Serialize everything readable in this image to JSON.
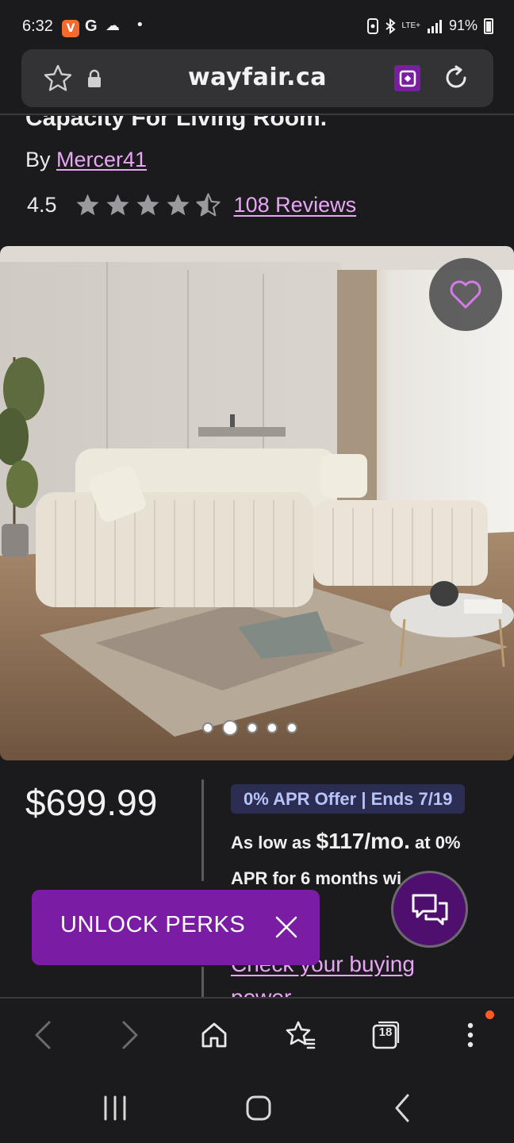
{
  "status_bar": {
    "time": "6:32",
    "google_glyph": "G",
    "brave_glyph": "V",
    "network": "LTE+",
    "battery": "91%",
    "icons": [
      "brave-icon",
      "google-icon",
      "weather-icon",
      "notification-dot-icon",
      "nfc-icon",
      "bluetooth-icon",
      "signal-icon",
      "battery-icon"
    ]
  },
  "url_bar": {
    "domain": "wayfair.ca",
    "icons": [
      "bookmark-star-icon",
      "lock-icon",
      "extension-icon",
      "reload-icon"
    ]
  },
  "product": {
    "title_partial": "Capacity For Living Room.",
    "by_prefix": "By ",
    "brand": "Mercer41",
    "rating": "4.5",
    "rating_fraction": 0.9,
    "reviews": "108 Reviews"
  },
  "gallery": {
    "image_alt": "sectional-sofa-photo",
    "dot_count": 5,
    "active_index": 1
  },
  "pricing": {
    "price": "$699.99",
    "apr_offer": "0% APR Offer",
    "apr_sep": "|",
    "apr_ends": "Ends 7/19",
    "finance_prefix": "As low as ",
    "finance_amount": "$117/mo.",
    "finance_suffix": " at 0%",
    "finance_line2": "APR for 6 months wi",
    "check_link": "Check your buying power"
  },
  "perks_banner": {
    "label": "UNLOCK PERKS"
  },
  "colors": {
    "background": "#1b1b1d",
    "accent_purple": "#7a1da4",
    "link_pink": "#e9a6f5",
    "apr_badge": "#2b2d52",
    "notification": "#ff5a1f"
  },
  "browser_toolbar": {
    "tabs_count": "18",
    "icons": [
      "back-icon",
      "forward-icon",
      "home-icon",
      "bookmarks-icon",
      "tabs-icon",
      "menu-icon"
    ]
  },
  "android_nav": {
    "icons": [
      "recents-icon",
      "home-nav-icon",
      "back-nav-icon"
    ]
  }
}
